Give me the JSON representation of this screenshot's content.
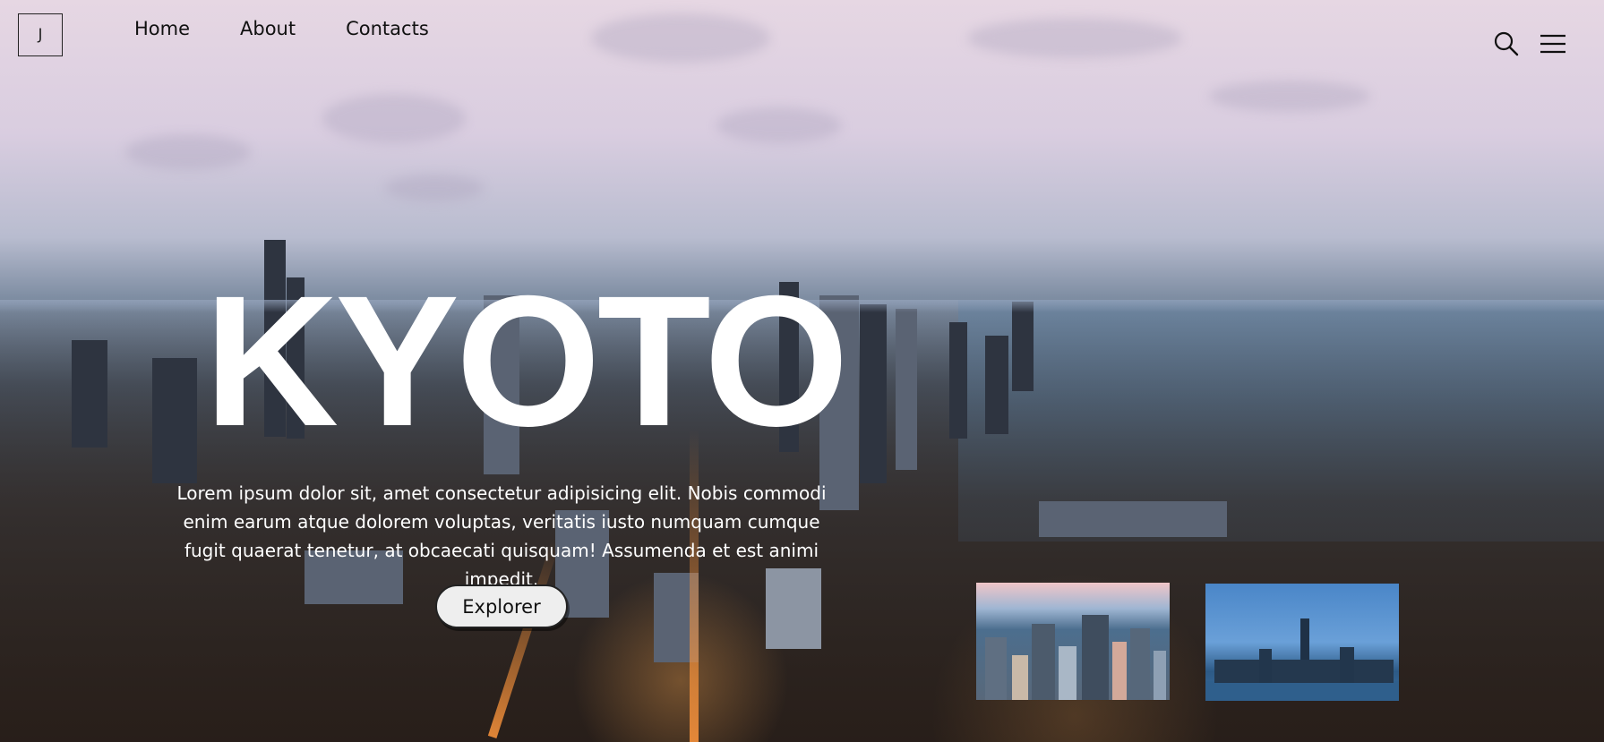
{
  "nav": {
    "logo_letter": "J",
    "links": [
      "Home",
      "About",
      "Contacts"
    ]
  },
  "icons": {
    "search": "search-icon",
    "menu": "hamburger-menu-icon"
  },
  "hero": {
    "title": "KYOTO",
    "description": "Lorem ipsum dolor sit, amet consectetur adipisicing elit. Nobis commodi enim earum atque dolorem voluptas, veritatis iusto numquam cumque fugit quaerat tenetur, at obcaecati quisquam! Assumenda et est animi impedit.",
    "cta_label": "Explorer"
  },
  "colors": {
    "title": "#ffffff",
    "button_bg": "#eeeeee",
    "nav_text": "#111111"
  }
}
